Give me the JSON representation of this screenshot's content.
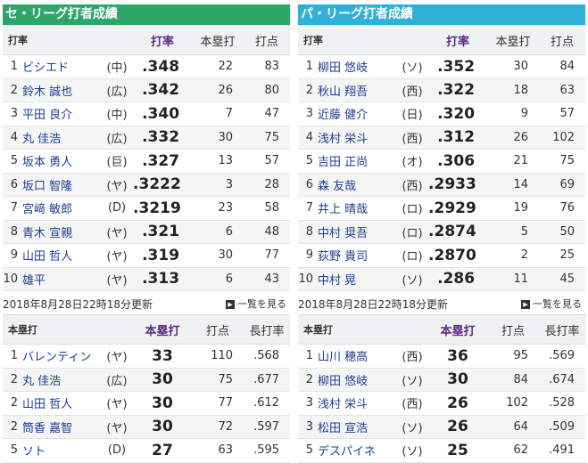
{
  "central": {
    "title": "セ・リーグ打者成績",
    "headers": [
      "打率",
      "打率",
      "本塁打",
      "打点"
    ],
    "rows": [
      {
        "rank": "1",
        "name": "ビシエド",
        "team": "(中)",
        "avg": ".348",
        "hr": "22",
        "rbi": "83"
      },
      {
        "rank": "2",
        "name": "鈴木 誠也",
        "team": "(広)",
        "avg": ".342",
        "hr": "26",
        "rbi": "80"
      },
      {
        "rank": "3",
        "name": "平田 良介",
        "team": "(中)",
        "avg": ".340",
        "hr": "7",
        "rbi": "47"
      },
      {
        "rank": "4",
        "name": "丸 佳浩",
        "team": "(広)",
        "avg": ".332",
        "hr": "30",
        "rbi": "75"
      },
      {
        "rank": "5",
        "name": "坂本 勇人",
        "team": "(巨)",
        "avg": ".327",
        "hr": "13",
        "rbi": "57"
      },
      {
        "rank": "6",
        "name": "坂口 智隆",
        "team": "(ヤ)",
        "avg": ".3222",
        "hr": "3",
        "rbi": "28"
      },
      {
        "rank": "7",
        "name": "宮﨑 敏郎",
        "team": "(D)",
        "avg": ".3219",
        "hr": "23",
        "rbi": "58"
      },
      {
        "rank": "8",
        "name": "青木 宣親",
        "team": "(ヤ)",
        "avg": ".321",
        "hr": "6",
        "rbi": "48"
      },
      {
        "rank": "9",
        "name": "山田 哲人",
        "team": "(ヤ)",
        "avg": ".319",
        "hr": "30",
        "rbi": "77"
      },
      {
        "rank": "10",
        "name": "雄平",
        "team": "(ヤ)",
        "avg": ".313",
        "hr": "6",
        "rbi": "43"
      }
    ],
    "updated": "2018年8月28日22時18分更新",
    "more": "一覧を見る"
  },
  "pacific": {
    "title": "パ・リーグ打者成績",
    "headers": [
      "打率",
      "打率",
      "本塁打",
      "打点"
    ],
    "rows": [
      {
        "rank": "1",
        "name": "柳田 悠岐",
        "team": "(ソ)",
        "avg": ".352",
        "hr": "30",
        "rbi": "84"
      },
      {
        "rank": "2",
        "name": "秋山 翔吾",
        "team": "(西)",
        "avg": ".322",
        "hr": "18",
        "rbi": "63"
      },
      {
        "rank": "3",
        "name": "近藤 健介",
        "team": "(日)",
        "avg": ".320",
        "hr": "9",
        "rbi": "57"
      },
      {
        "rank": "4",
        "name": "浅村 栄斗",
        "team": "(西)",
        "avg": ".312",
        "hr": "26",
        "rbi": "102"
      },
      {
        "rank": "5",
        "name": "吉田 正尚",
        "team": "(オ)",
        "avg": ".306",
        "hr": "21",
        "rbi": "75"
      },
      {
        "rank": "6",
        "name": "森 友哉",
        "team": "(西)",
        "avg": ".2933",
        "hr": "14",
        "rbi": "69"
      },
      {
        "rank": "7",
        "name": "井上 晴哉",
        "team": "(ロ)",
        "avg": ".2929",
        "hr": "19",
        "rbi": "76"
      },
      {
        "rank": "8",
        "name": "中村 奨吾",
        "team": "(ロ)",
        "avg": ".2874",
        "hr": "5",
        "rbi": "50"
      },
      {
        "rank": "9",
        "name": "荻野 貴司",
        "team": "(ロ)",
        "avg": ".2870",
        "hr": "2",
        "rbi": "25"
      },
      {
        "rank": "10",
        "name": "中村 晃",
        "team": "(ソ)",
        "avg": ".286",
        "hr": "11",
        "rbi": "45"
      }
    ],
    "updated": "2018年8月28日22時18分更新",
    "more": "一覧を見る"
  },
  "central_hr": {
    "headers": [
      "本塁打",
      "本塁打",
      "打点",
      "長打率"
    ],
    "rows": [
      {
        "rank": "1",
        "name": "バレンティン",
        "team": "(ヤ)",
        "hr": "33",
        "rbi": "110",
        "slg": ".568"
      },
      {
        "rank": "2",
        "name": "丸 佳浩",
        "team": "(広)",
        "hr": "30",
        "rbi": "75",
        "slg": ".677"
      },
      {
        "rank": "2",
        "name": "山田 哲人",
        "team": "(ヤ)",
        "hr": "30",
        "rbi": "77",
        "slg": ".612"
      },
      {
        "rank": "2",
        "name": "筒香 嘉智",
        "team": "(ヤ)",
        "hr": "30",
        "rbi": "72",
        "slg": ".597"
      },
      {
        "rank": "5",
        "name": "ソト",
        "team": "(D)",
        "hr": "27",
        "rbi": "63",
        "slg": ".595"
      }
    ]
  },
  "pacific_hr": {
    "headers": [
      "本塁打",
      "本塁打",
      "打点",
      "長打率"
    ],
    "rows": [
      {
        "rank": "1",
        "name": "山川 穂高",
        "team": "(西)",
        "hr": "36",
        "rbi": "95",
        "slg": ".569"
      },
      {
        "rank": "2",
        "name": "柳田 悠岐",
        "team": "(ソ)",
        "hr": "30",
        "rbi": "84",
        "slg": ".674"
      },
      {
        "rank": "3",
        "name": "浅村 栄斗",
        "team": "(西)",
        "hr": "26",
        "rbi": "102",
        "slg": ".528"
      },
      {
        "rank": "3",
        "name": "松田 宣浩",
        "team": "(ソ)",
        "hr": "26",
        "rbi": "64",
        "slg": ".509"
      },
      {
        "rank": "5",
        "name": "デスパイネ",
        "team": "(ソ)",
        "hr": "25",
        "rbi": "62",
        "slg": ".491"
      }
    ]
  }
}
